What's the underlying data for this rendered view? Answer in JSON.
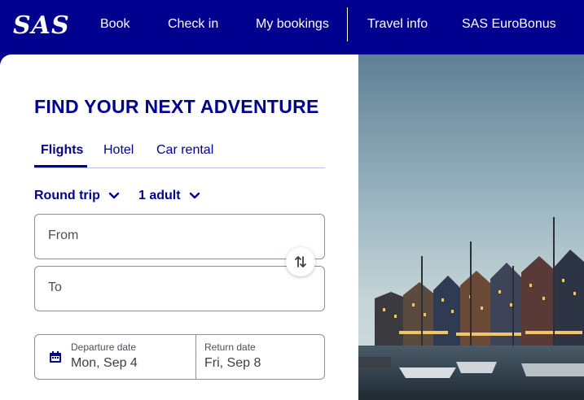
{
  "header": {
    "logo_text": "SAS",
    "nav": [
      "Book",
      "Check in",
      "My bookings",
      "Travel info",
      "SAS EuroBonus"
    ]
  },
  "booking": {
    "title": "FIND YOUR NEXT ADVENTURE",
    "tabs": [
      "Flights",
      "Hotel",
      "Car rental"
    ],
    "active_tab": "Flights",
    "trip_type": "Round trip",
    "passengers": "1 adult",
    "from_label": "From",
    "to_label": "To",
    "departure_label": "Departure date",
    "departure_value": "Mon, Sep 4",
    "return_label": "Return date",
    "return_value": "Fri, Sep 8"
  },
  "colors": {
    "brand": "#00008f",
    "accent_border": "#8a8f9c"
  },
  "icons": [
    "chevron-down-icon",
    "swap-icon",
    "calendar-icon"
  ]
}
